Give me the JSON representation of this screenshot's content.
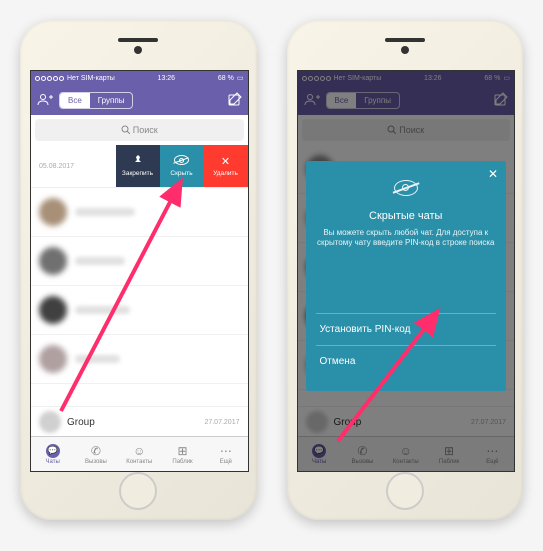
{
  "status": {
    "carrier": "Нет SIM-карты",
    "time": "13:26",
    "battery": "68 %"
  },
  "header": {
    "tab_all": "Все",
    "tab_groups": "Группы"
  },
  "search": {
    "placeholder": "Поиск"
  },
  "chat1": {
    "date": "05.08.2017"
  },
  "swipe": {
    "pin": "Закрепить",
    "hide": "Скрыть",
    "delete": "Удалить"
  },
  "group": {
    "name": "Group",
    "date": "27.07.2017"
  },
  "bottom": {
    "chats": "Чаты",
    "calls": "Вызовы",
    "contacts": "Контакты",
    "public": "Паблик",
    "more": "Ещё"
  },
  "modal": {
    "title": "Скрытые чаты",
    "text": "Вы можете скрыть любой чат. Для доступа к скрытому чату введите PIN-код в строке поиска",
    "set_pin": "Установить PIN-код",
    "cancel": "Отмена"
  }
}
